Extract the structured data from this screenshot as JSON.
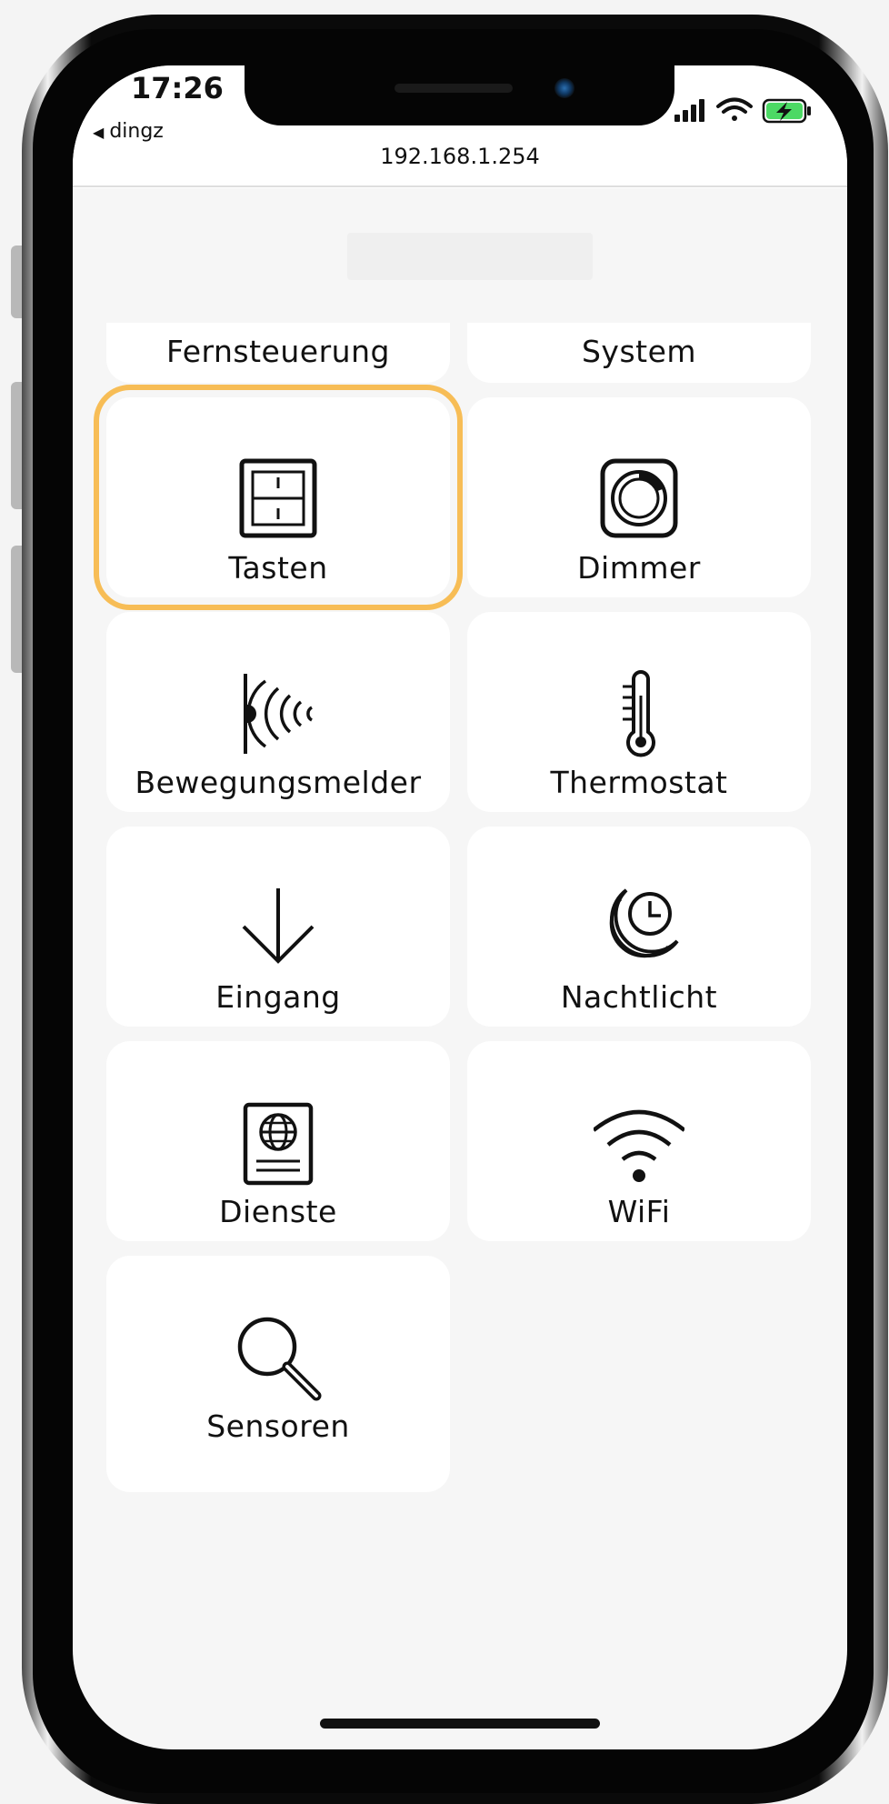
{
  "status_bar": {
    "time": "17:26",
    "back_app": "dingz",
    "back_arrow": "◀",
    "icons": [
      "cellular-signal-icon",
      "wifi-icon",
      "battery-charging-icon"
    ],
    "battery_color": "#4cd964"
  },
  "browser": {
    "url": "192.168.1.254"
  },
  "menu": {
    "accent_color": "#f7bd56",
    "items": [
      {
        "label": "Fernsteuerung"
      },
      {
        "label": "System"
      },
      {
        "label": "Tasten",
        "icon": "switch-panel-icon",
        "selected": true
      },
      {
        "label": "Dimmer",
        "icon": "dimmer-knob-icon"
      },
      {
        "label": "Bewegungsmelder",
        "icon": "motion-sensor-icon"
      },
      {
        "label": "Thermostat",
        "icon": "thermometer-icon"
      },
      {
        "label": "Eingang",
        "icon": "arrow-down-icon"
      },
      {
        "label": "Nachtlicht",
        "icon": "moon-clock-icon"
      },
      {
        "label": "Dienste",
        "icon": "passport-globe-icon"
      },
      {
        "label": "WiFi",
        "icon": "wifi-icon"
      },
      {
        "label": "Sensoren",
        "icon": "magnifier-icon"
      }
    ]
  }
}
